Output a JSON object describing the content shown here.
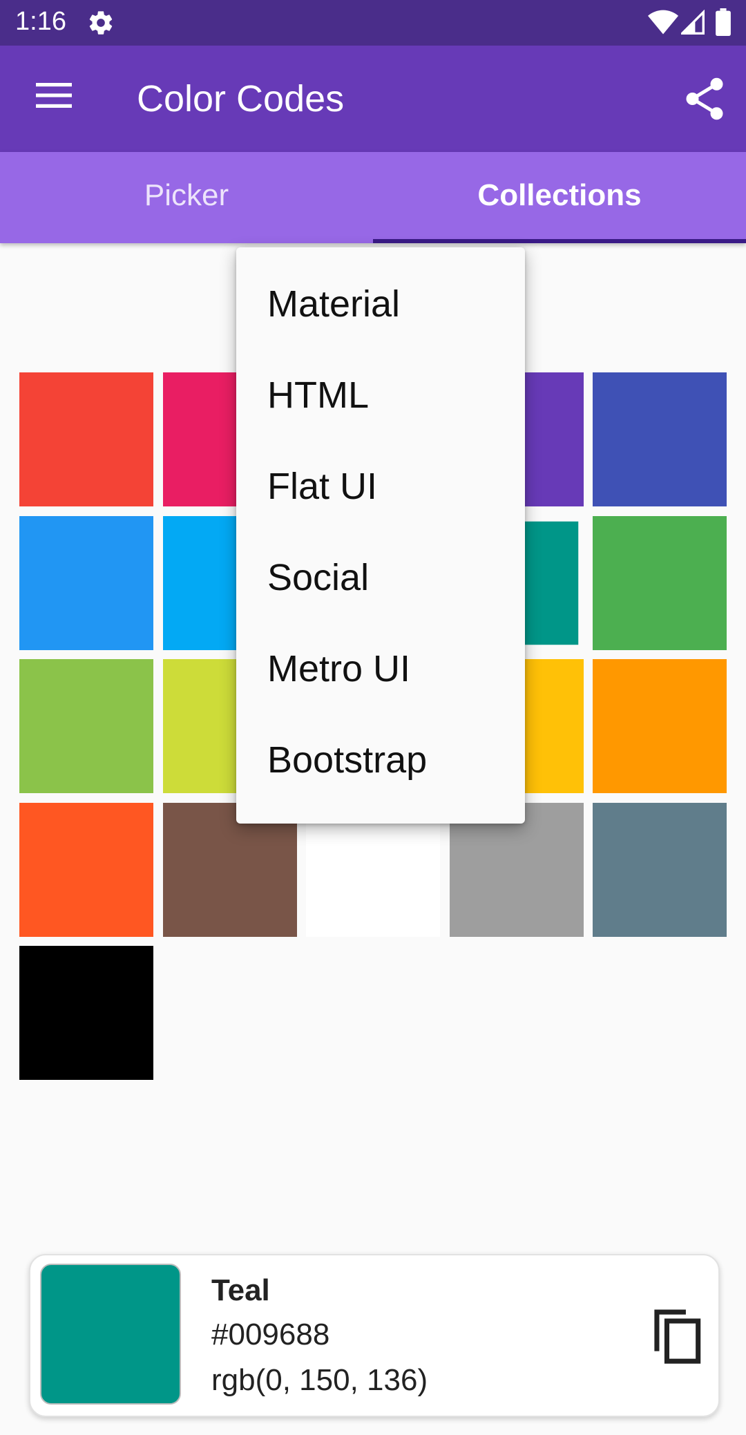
{
  "status_bar": {
    "time": "1:16"
  },
  "app_bar": {
    "title": "Color Codes"
  },
  "tabs": [
    {
      "label": "Picker",
      "selected": false
    },
    {
      "label": "Collections",
      "selected": true
    }
  ],
  "dropdown": {
    "items": [
      "Material",
      "HTML",
      "Flat UI",
      "Social",
      "Metro UI",
      "Bootstrap"
    ]
  },
  "swatches": [
    "#f44336",
    "#e91e63",
    "#9c27b0",
    "#673ab7",
    "#3f51b5",
    "#2196f3",
    "#03a9f4",
    "#00bcd4",
    "#009688",
    "#4caf50",
    "#8bc34a",
    "#cddc39",
    "#ffeb3b",
    "#ffc107",
    "#ff9800",
    "#ff5722",
    "#795548",
    "#ffffff",
    "#9e9e9e",
    "#607d8b",
    "#000000"
  ],
  "selected_color": {
    "name": "Teal",
    "hex": "#009688",
    "rgb": "rgb(0, 150, 136)"
  },
  "colors": {
    "status_bar": "#4a2d8a",
    "app_bar": "#673ab7",
    "tab_bar": "#9768e6",
    "tab_indicator": "#3a1a86"
  }
}
